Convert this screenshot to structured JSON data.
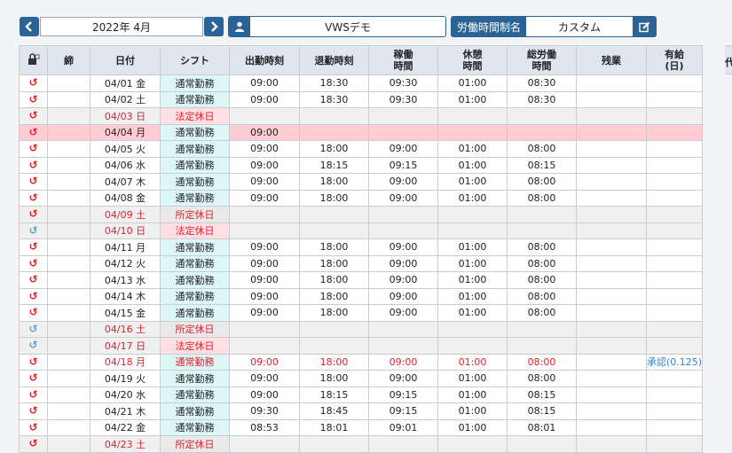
{
  "header": {
    "month_label": "2022年 4月",
    "user_name": "VWSデモ",
    "system_label": "労働時間制名",
    "system_value": "カスタム",
    "prev_icon": "chevron-left-icon",
    "next_icon": "chevron-right-icon",
    "user_icon": "user-icon",
    "edit_icon": "edit-icon"
  },
  "columns": {
    "c1": "締",
    "c2": "日付",
    "c3": "シフト",
    "c4": "出勤時刻",
    "c5": "退勤時刻",
    "c6a": "稼働",
    "c6b": "時間",
    "c7a": "休憩",
    "c7b": "時間",
    "c8a": "総労働",
    "c8b": "時間",
    "c9": "残業",
    "c10a": "有給",
    "c10b": "(日)",
    "c11": "代"
  },
  "rows": [
    {
      "icon": "r",
      "date": "04/01 金",
      "shift": "通常勤務",
      "in": "09:00",
      "out": "18:30",
      "work": "09:30",
      "break": "01:00",
      "total": "08:30",
      "ot": "",
      "paid": "",
      "type": "normal"
    },
    {
      "icon": "r",
      "date": "04/02 土",
      "shift": "通常勤務",
      "in": "09:00",
      "out": "18:30",
      "work": "09:30",
      "break": "01:00",
      "total": "08:30",
      "ot": "",
      "paid": "",
      "type": "normal"
    },
    {
      "icon": "r",
      "date": "04/03 日",
      "shift": "法定休日",
      "in": "",
      "out": "",
      "work": "",
      "break": "",
      "total": "",
      "ot": "",
      "paid": "",
      "type": "hol"
    },
    {
      "icon": "r",
      "date": "04/04 月",
      "shift": "通常勤務",
      "in": "09:00",
      "out": "",
      "work": "",
      "break": "",
      "total": "",
      "ot": "",
      "paid": "",
      "type": "pink"
    },
    {
      "icon": "r",
      "date": "04/05 火",
      "shift": "通常勤務",
      "in": "09:00",
      "out": "18:00",
      "work": "09:00",
      "break": "01:00",
      "total": "08:00",
      "ot": "",
      "paid": "",
      "type": "normal"
    },
    {
      "icon": "r",
      "date": "04/06 水",
      "shift": "通常勤務",
      "in": "09:00",
      "out": "18:15",
      "work": "09:15",
      "break": "01:00",
      "total": "08:15",
      "ot": "",
      "paid": "",
      "type": "normal"
    },
    {
      "icon": "r",
      "date": "04/07 木",
      "shift": "通常勤務",
      "in": "09:00",
      "out": "18:00",
      "work": "09:00",
      "break": "01:00",
      "total": "08:00",
      "ot": "",
      "paid": "",
      "type": "normal"
    },
    {
      "icon": "r",
      "date": "04/08 金",
      "shift": "通常勤務",
      "in": "09:00",
      "out": "18:00",
      "work": "09:00",
      "break": "01:00",
      "total": "08:00",
      "ot": "",
      "paid": "",
      "type": "normal"
    },
    {
      "icon": "r",
      "date": "04/09 土",
      "shift": "所定休日",
      "in": "",
      "out": "",
      "work": "",
      "break": "",
      "total": "",
      "ot": "",
      "paid": "",
      "type": "hol2"
    },
    {
      "icon": "b",
      "date": "04/10 日",
      "shift": "法定休日",
      "in": "",
      "out": "",
      "work": "",
      "break": "",
      "total": "",
      "ot": "",
      "paid": "",
      "type": "hol"
    },
    {
      "icon": "r",
      "date": "04/11 月",
      "shift": "通常勤務",
      "in": "09:00",
      "out": "18:00",
      "work": "09:00",
      "break": "01:00",
      "total": "08:00",
      "ot": "",
      "paid": "",
      "type": "normal"
    },
    {
      "icon": "r",
      "date": "04/12 火",
      "shift": "通常勤務",
      "in": "09:00",
      "out": "18:00",
      "work": "09:00",
      "break": "01:00",
      "total": "08:00",
      "ot": "",
      "paid": "",
      "type": "normal"
    },
    {
      "icon": "r",
      "date": "04/13 水",
      "shift": "通常勤務",
      "in": "09:00",
      "out": "18:00",
      "work": "09:00",
      "break": "01:00",
      "total": "08:00",
      "ot": "",
      "paid": "",
      "type": "normal"
    },
    {
      "icon": "r",
      "date": "04/14 木",
      "shift": "通常勤務",
      "in": "09:00",
      "out": "18:00",
      "work": "09:00",
      "break": "01:00",
      "total": "08:00",
      "ot": "",
      "paid": "",
      "type": "normal"
    },
    {
      "icon": "r",
      "date": "04/15 金",
      "shift": "通常勤務",
      "in": "09:00",
      "out": "18:00",
      "work": "09:00",
      "break": "01:00",
      "total": "08:00",
      "ot": "",
      "paid": "",
      "type": "normal"
    },
    {
      "icon": "b",
      "date": "04/16 土",
      "shift": "所定休日",
      "in": "",
      "out": "",
      "work": "",
      "break": "",
      "total": "",
      "ot": "",
      "paid": "",
      "type": "hol2"
    },
    {
      "icon": "b",
      "date": "04/17 日",
      "shift": "法定休日",
      "in": "",
      "out": "",
      "work": "",
      "break": "",
      "total": "",
      "ot": "",
      "paid": "",
      "type": "hol"
    },
    {
      "icon": "r",
      "date": "04/18 月",
      "shift": "通常勤務",
      "in": "09:00",
      "out": "18:00",
      "work": "09:00",
      "break": "01:00",
      "total": "08:00",
      "ot": "",
      "paid": "承認(0.125)",
      "type": "redtext"
    },
    {
      "icon": "r",
      "date": "04/19 火",
      "shift": "通常勤務",
      "in": "09:00",
      "out": "18:00",
      "work": "09:00",
      "break": "01:00",
      "total": "08:00",
      "ot": "",
      "paid": "",
      "type": "normal"
    },
    {
      "icon": "r",
      "date": "04/20 水",
      "shift": "通常勤務",
      "in": "09:00",
      "out": "18:15",
      "work": "09:15",
      "break": "01:00",
      "total": "08:15",
      "ot": "",
      "paid": "",
      "type": "normal"
    },
    {
      "icon": "r",
      "date": "04/21 木",
      "shift": "通常勤務",
      "in": "09:30",
      "out": "18:45",
      "work": "09:15",
      "break": "01:00",
      "total": "08:15",
      "ot": "",
      "paid": "",
      "type": "normal"
    },
    {
      "icon": "r",
      "date": "04/22 金",
      "shift": "通常勤務",
      "in": "08:53",
      "out": "18:01",
      "work": "09:01",
      "break": "01:00",
      "total": "08:01",
      "ot": "",
      "paid": "",
      "type": "normal"
    },
    {
      "icon": "r",
      "date": "04/23 土",
      "shift": "所定休日",
      "in": "",
      "out": "",
      "work": "",
      "break": "",
      "total": "",
      "ot": "",
      "paid": "",
      "type": "hol2"
    }
  ]
}
